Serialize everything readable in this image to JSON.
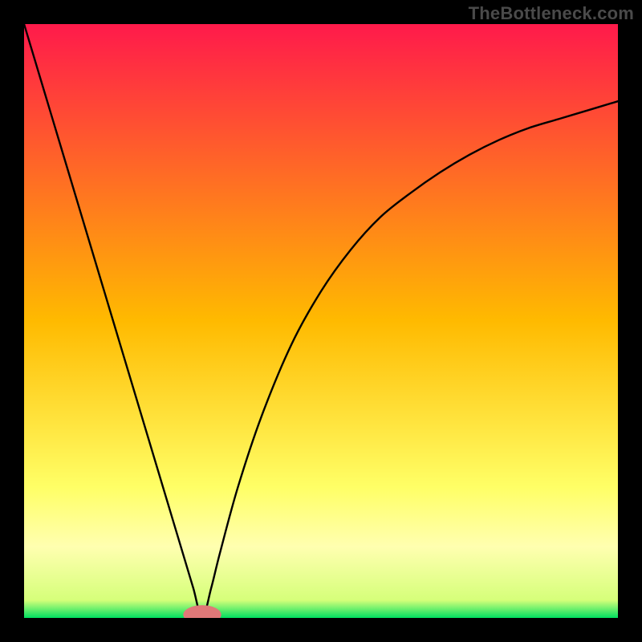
{
  "watermark": "TheBottleneck.com",
  "chart_data": {
    "type": "line",
    "title": "",
    "xlabel": "",
    "ylabel": "",
    "xlim": [
      0,
      100
    ],
    "ylim": [
      0,
      100
    ],
    "grid": false,
    "legend": false,
    "min_point": {
      "x": 30,
      "y": 0
    },
    "min_marker": {
      "color": "#e07878",
      "rx": 3.2,
      "ry": 1.6
    },
    "gradient_stops": [
      {
        "offset": 0.0,
        "color": "#ff1a4b"
      },
      {
        "offset": 0.5,
        "color": "#ffba00"
      },
      {
        "offset": 0.78,
        "color": "#ffff66"
      },
      {
        "offset": 0.88,
        "color": "#ffffb0"
      },
      {
        "offset": 0.97,
        "color": "#d6ff7a"
      },
      {
        "offset": 1.0,
        "color": "#00e060"
      }
    ],
    "series": [
      {
        "name": "bottleneck-curve",
        "x": [
          0,
          3,
          6,
          9,
          12,
          15,
          18,
          21,
          24,
          27,
          28.5,
          30,
          31.5,
          33,
          36,
          40,
          45,
          50,
          55,
          60,
          65,
          70,
          75,
          80,
          85,
          90,
          95,
          100
        ],
        "values": [
          100,
          90,
          80,
          70,
          60,
          50,
          40,
          30,
          20,
          10,
          5,
          0,
          5,
          11,
          22,
          34,
          46,
          55,
          62,
          67.5,
          71.5,
          75,
          78,
          80.5,
          82.5,
          84,
          85.5,
          87
        ]
      }
    ]
  }
}
